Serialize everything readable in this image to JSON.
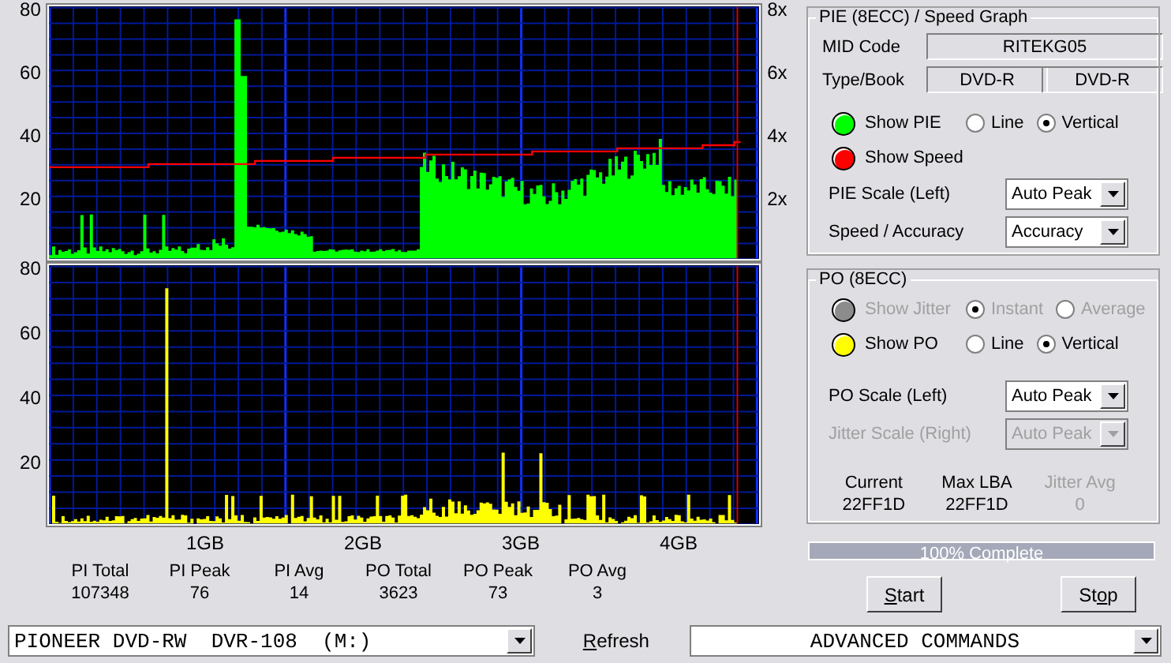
{
  "pie_graph": {
    "left_ticks": [
      "80",
      "60",
      "40",
      "20"
    ],
    "right_ticks": [
      "8x",
      "6x",
      "4x",
      "2x"
    ]
  },
  "po_graph": {
    "left_ticks": [
      "80",
      "60",
      "40",
      "20"
    ]
  },
  "x_ticks": [
    "1GB",
    "2GB",
    "3GB",
    "4GB"
  ],
  "stats": [
    {
      "label": "PI Total",
      "value": "107348"
    },
    {
      "label": "PI Peak",
      "value": "76"
    },
    {
      "label": "PI Avg",
      "value": "14"
    },
    {
      "label": "PO Total",
      "value": "3623"
    },
    {
      "label": "PO Peak",
      "value": "73"
    },
    {
      "label": "PO Avg",
      "value": "3"
    }
  ],
  "pie_panel": {
    "title": "PIE (8ECC) / Speed Graph",
    "mid_label": "MID Code",
    "mid_value": "RITEKG05",
    "type_label": "Type/Book",
    "type_value": "DVD-R",
    "book_value": "DVD-R",
    "toggles": [
      {
        "label": "Show PIE",
        "color": "#00ff00",
        "disabled": false,
        "radios": [
          {
            "label": "Line",
            "selected": false
          },
          {
            "label": "Vertical",
            "selected": true
          }
        ]
      },
      {
        "label": "Show Speed",
        "color": "#ff0000",
        "disabled": false
      }
    ],
    "selects": [
      {
        "label": "PIE Scale (Left)",
        "value": "Auto Peak",
        "disabled": false
      },
      {
        "label": "Speed / Accuracy",
        "value": "Accuracy",
        "disabled": false
      }
    ]
  },
  "po_panel": {
    "title": "PO (8ECC)",
    "toggles": [
      {
        "label": "Show Jitter",
        "color": "#8c8c8c",
        "disabled": true,
        "radios": [
          {
            "label": "Instant",
            "selected": true
          },
          {
            "label": "Average",
            "selected": false
          }
        ]
      },
      {
        "label": "Show PO",
        "color": "#ffff00",
        "disabled": false,
        "radios": [
          {
            "label": "Line",
            "selected": false
          },
          {
            "label": "Vertical",
            "selected": true
          }
        ]
      }
    ],
    "selects": [
      {
        "label": "PO Scale (Left)",
        "value": "Auto Peak",
        "disabled": false
      },
      {
        "label": "Jitter Scale (Right)",
        "value": "Auto Peak",
        "disabled": true
      }
    ],
    "readouts": [
      {
        "label": "Current",
        "value": "22FF1D",
        "disabled": false
      },
      {
        "label": "Max LBA",
        "value": "22FF1D",
        "disabled": false
      },
      {
        "label": "Jitter Avg",
        "value": "0",
        "disabled": true
      }
    ]
  },
  "progress": {
    "label": "100% Complete",
    "level": 1
  },
  "buttons": [
    {
      "key": "S",
      "after": "tart"
    },
    {
      "before": "St",
      "key": "o",
      "after": "p"
    }
  ],
  "drive_select": "PIONEER DVD-RW  DVR-108  (M:)",
  "refresh": {
    "key": "R",
    "after": "efresh"
  },
  "command_select": "ADVANCED COMMANDS"
}
